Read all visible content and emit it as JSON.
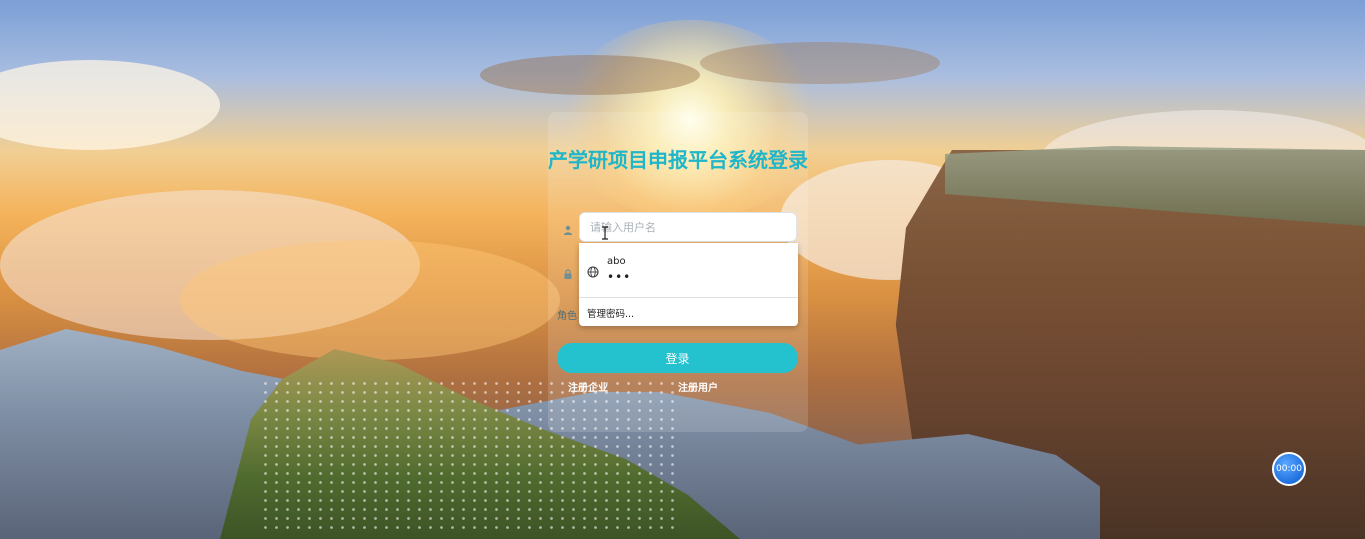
{
  "login": {
    "title": "产学研项目申报平台系统登录",
    "username_placeholder": "请输入用户名",
    "role_label": "角色",
    "login_button": "登录",
    "register_company_link": "注册企业",
    "register_user_link": "注册用户"
  },
  "autofill": {
    "saved_username": "abo",
    "saved_password_mask": "•••",
    "manage_passwords": "管理密码..."
  },
  "timer": {
    "text": "00:00"
  },
  "colors": {
    "accent": "#24c1cf",
    "title": "#1fb6c9",
    "timer_bg": "#1f6fe0"
  },
  "icons": {
    "user_field": "user-icon",
    "password_field": "lock-icon",
    "autofill_site": "globe-icon",
    "cursor": "text-cursor-icon"
  }
}
